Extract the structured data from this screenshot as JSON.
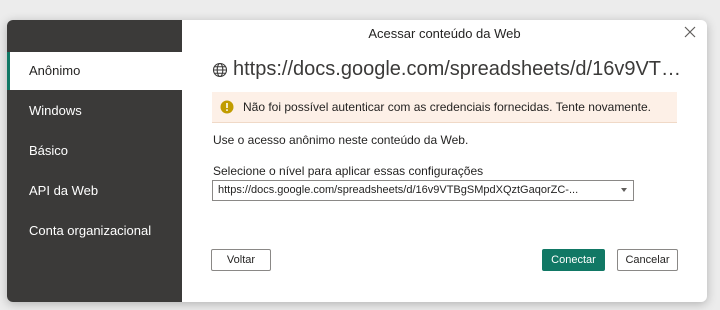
{
  "dialog": {
    "title": "Acessar conteúdo da Web",
    "close_icon": "close-icon"
  },
  "sidebar": {
    "items": [
      {
        "label": "Anônimo",
        "active": true
      },
      {
        "label": "Windows",
        "active": false
      },
      {
        "label": "Básico",
        "active": false
      },
      {
        "label": "API da Web",
        "active": false
      },
      {
        "label": "Conta organizacional",
        "active": false
      }
    ]
  },
  "main": {
    "url": "https://docs.google.com/spreadsheets/d/16v9VTBg...",
    "url_icon": "globe-icon",
    "warning": {
      "icon": "warning-icon",
      "text": "Não foi possível autenticar com as credenciais fornecidas. Tente novamente."
    },
    "description": "Use o acesso anônimo neste conteúdo da Web.",
    "level_label": "Selecione o nível para aplicar essas configurações",
    "level_value": "https://docs.google.com/spreadsheets/d/16v9VTBgSMpdXQztGaqorZC-..."
  },
  "buttons": {
    "back": "Voltar",
    "connect": "Conectar",
    "cancel": "Cancelar"
  },
  "colors": {
    "accent": "#117865",
    "sidebar": "#3b3a39",
    "warning_bg": "#fdf0e7"
  }
}
